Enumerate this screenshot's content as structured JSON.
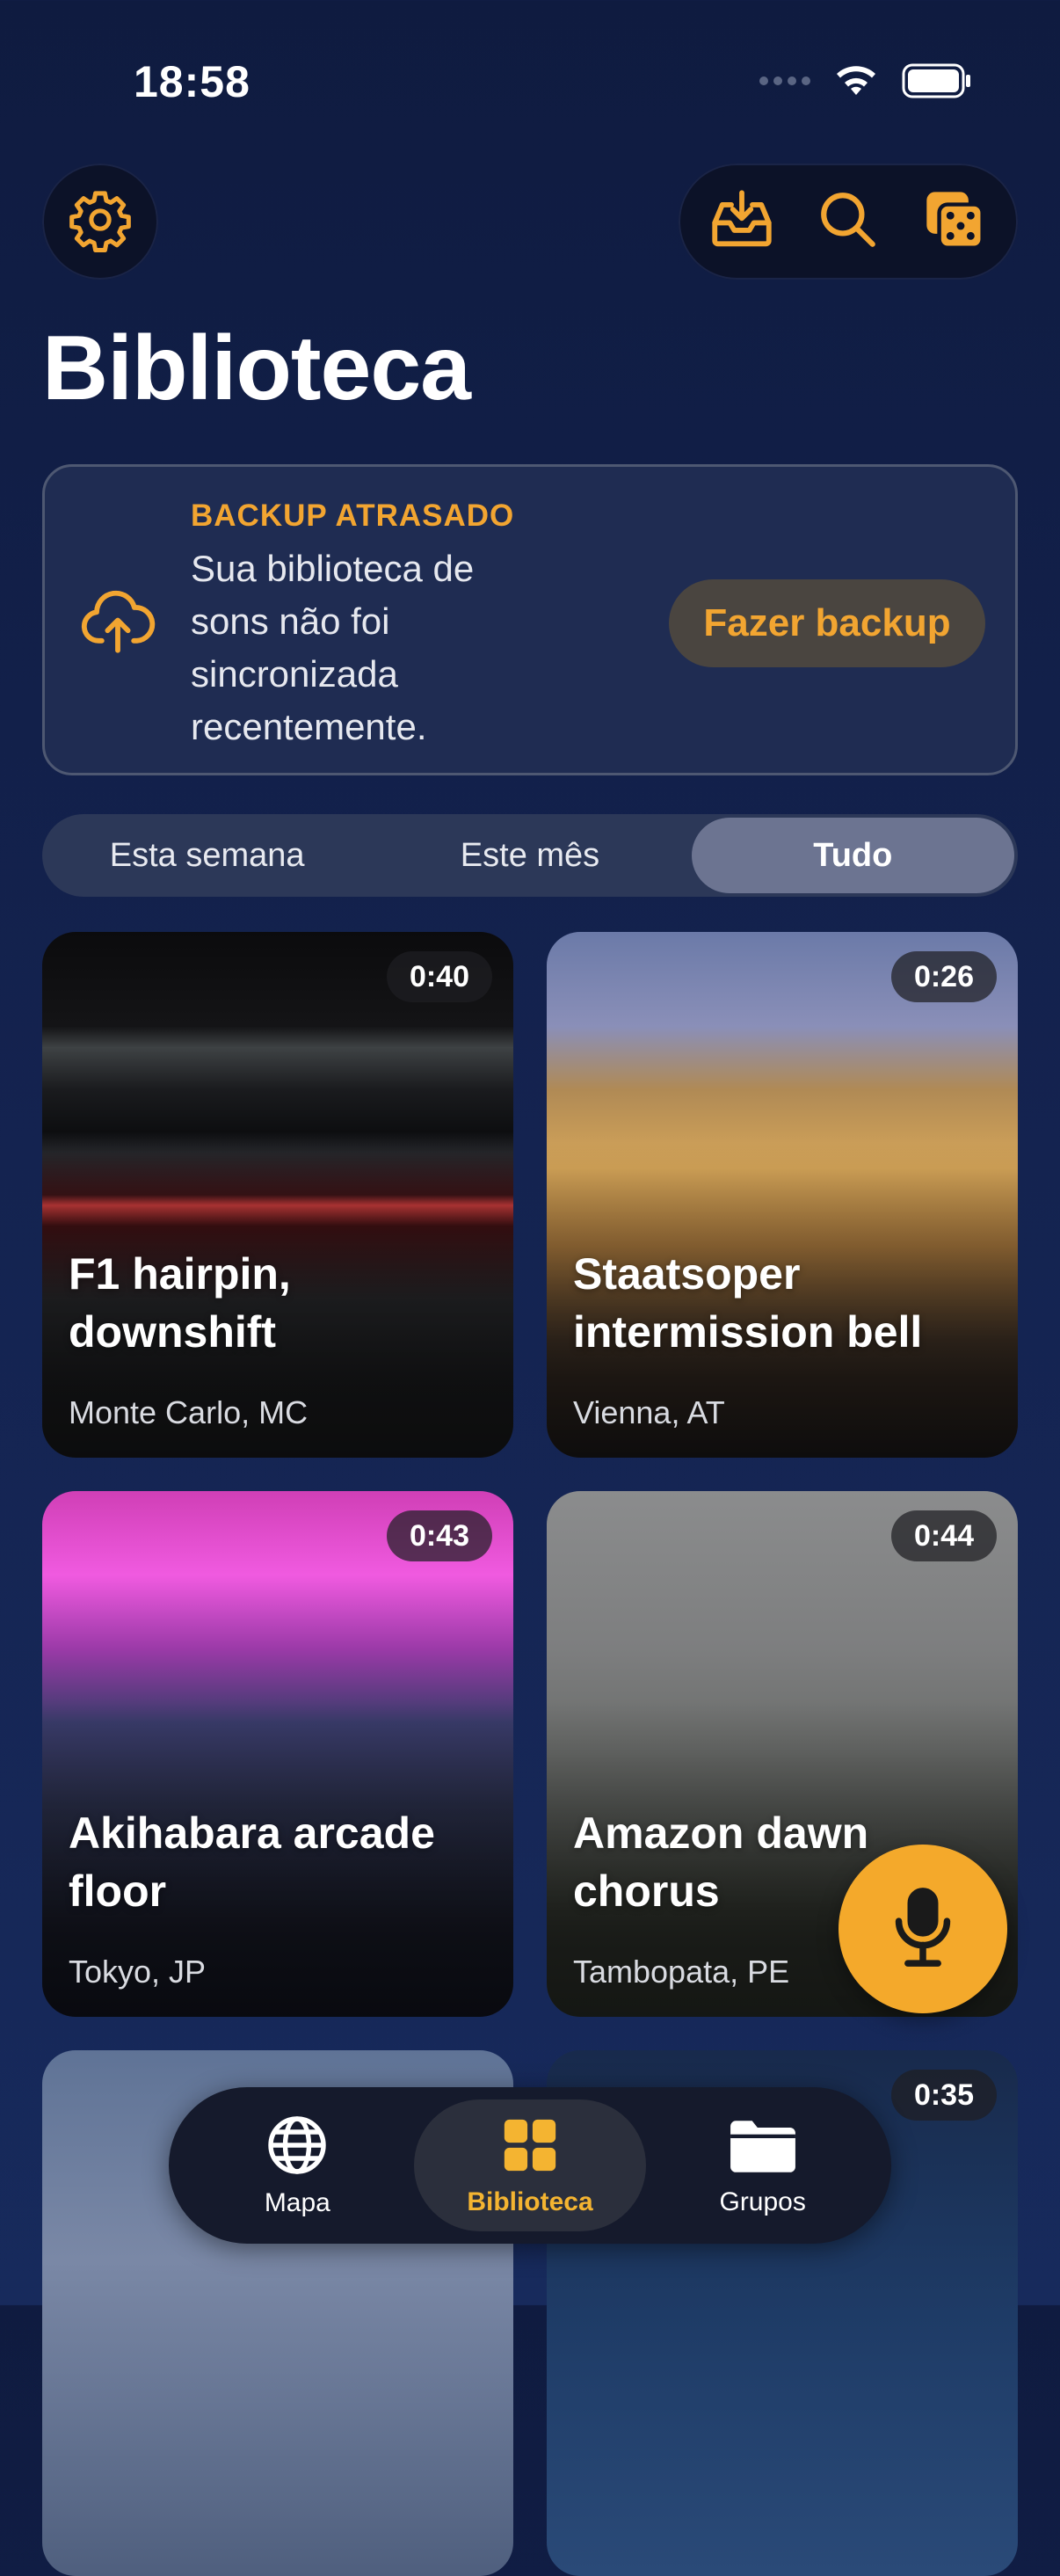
{
  "status_bar": {
    "time": "18:58"
  },
  "page": {
    "title": "Biblioteca"
  },
  "backup": {
    "eyebrow": "BACKUP ATRASADO",
    "message": "Sua biblioteca de sons não foi sincronizada recentemente.",
    "button_label": "Fazer backup"
  },
  "filter": {
    "options": [
      "Esta semana",
      "Este mês",
      "Tudo"
    ],
    "selected": "Tudo"
  },
  "recordings": [
    {
      "title": "F1 hairpin, downshift",
      "location": "Monte Carlo, MC",
      "duration": "0:40"
    },
    {
      "title": "Staatsoper intermission bell",
      "location": "Vienna, AT",
      "duration": "0:26"
    },
    {
      "title": "Akihabara arcade floor",
      "location": "Tokyo, JP",
      "duration": "0:43"
    },
    {
      "title": "Amazon dawn chorus",
      "location": "Tambopata, PE",
      "duration": "0:44"
    },
    {
      "title": "",
      "location": "",
      "duration": ""
    },
    {
      "title": "",
      "location": "",
      "duration": "0:35"
    }
  ],
  "tabbar": {
    "tabs": [
      {
        "label": "Mapa",
        "icon": "globe-icon"
      },
      {
        "label": "Biblioteca",
        "icon": "grid-icon"
      },
      {
        "label": "Grupos",
        "icon": "folder-icon"
      }
    ],
    "selected": "Biblioteca"
  },
  "colors": {
    "accent": "#f4a92b",
    "background": "#142350",
    "card_border": "#4e5872"
  }
}
